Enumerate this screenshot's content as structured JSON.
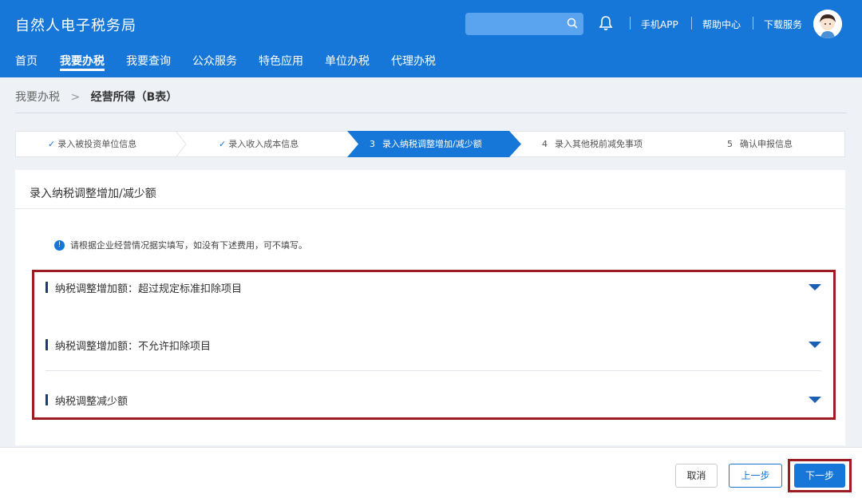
{
  "header": {
    "title": "自然人电子税务局",
    "links": [
      "手机APP",
      "帮助中心",
      "下载服务"
    ],
    "nav": [
      "首页",
      "我要办税",
      "我要查询",
      "公众服务",
      "特色应用",
      "单位办税",
      "代理办税"
    ],
    "active_nav": "我要办税"
  },
  "breadcrumb": {
    "parent": "我要办税",
    "separator": ">",
    "current": "经营所得（B表）"
  },
  "steps": [
    {
      "label": "录入被投资单位信息",
      "state": "done",
      "prefix": "✓"
    },
    {
      "label": "录入收入成本信息",
      "state": "done",
      "prefix": "✓"
    },
    {
      "label": "录入纳税调整增加/减少额",
      "state": "active",
      "prefix": "3"
    },
    {
      "label": "录入其他税前减免事项",
      "state": "todo",
      "prefix": "4"
    },
    {
      "label": "确认申报信息",
      "state": "todo",
      "prefix": "5"
    }
  ],
  "panel": {
    "title": "录入纳税调整增加/减少额",
    "notice": "请根据企业经营情况据实填写，如没有下述费用，可不填写。",
    "sections": [
      {
        "label": "纳税调整增加额：超过规定标准扣除项目"
      },
      {
        "label": "纳税调整增加额：不允许扣除项目"
      },
      {
        "label": "纳税调整减少额"
      }
    ]
  },
  "footer": {
    "cancel": "取消",
    "prev": "上一步",
    "next": "下一步"
  },
  "colors": {
    "primary": "#1677d8",
    "highlight": "#9e1b24"
  }
}
